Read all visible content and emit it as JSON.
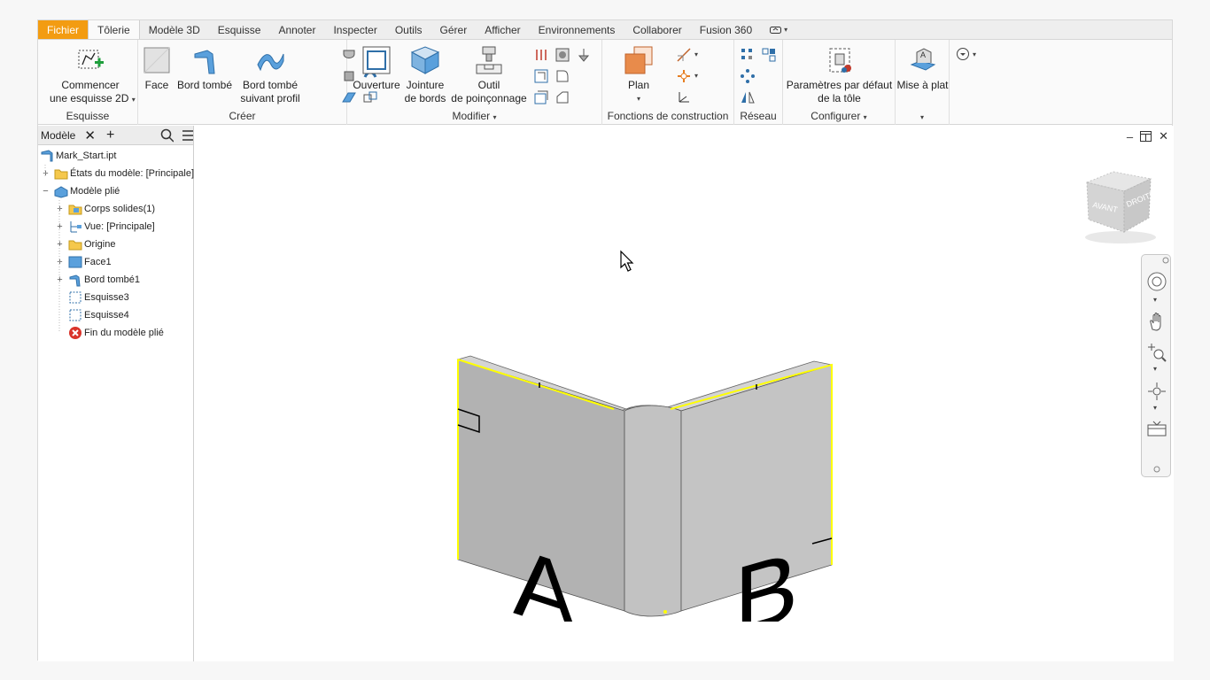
{
  "menu": {
    "tabs": [
      "Fichier",
      "Tôlerie",
      "Modèle 3D",
      "Esquisse",
      "Annoter",
      "Inspecter",
      "Outils",
      "Gérer",
      "Afficher",
      "Environnements",
      "Collaborer",
      "Fusion 360"
    ]
  },
  "ribbon": {
    "esquisse": {
      "start_line1": "Commencer",
      "start_line2": "une esquisse 2D",
      "title": "Esquisse"
    },
    "creer": {
      "face": "Face",
      "bord_tombe": "Bord tombé",
      "bord_profil_line1": "Bord tombé",
      "bord_profil_line2": "suivant profil",
      "title": "Créer"
    },
    "modifier": {
      "ouverture": "Ouverture",
      "jointure_line1": "Jointure",
      "jointure_line2": "de bords",
      "outil_line1": "Outil",
      "outil_line2": "de poinçonnage",
      "title": "Modifier"
    },
    "construction": {
      "plan": "Plan",
      "title": "Fonctions de construction"
    },
    "reseau": {
      "title": "Réseau"
    },
    "configurer": {
      "param_line1": "Paramètres par défaut",
      "param_line2": "de la tôle",
      "title": "Configurer"
    },
    "flatten": {
      "label": "Mise à plat"
    }
  },
  "browser": {
    "tab_label": "Modèle",
    "items": [
      {
        "label": "Mark_Start.ipt"
      },
      {
        "label": "États du modèle: [Principale]"
      },
      {
        "label": "Modèle plié"
      },
      {
        "label": "Corps solides(1)"
      },
      {
        "label": "Vue: [Principale]"
      },
      {
        "label": "Origine"
      },
      {
        "label": "Face1"
      },
      {
        "label": "Bord tombé1"
      },
      {
        "label": "Esquisse3"
      },
      {
        "label": "Esquisse4"
      },
      {
        "label": "Fin du modèle plié"
      }
    ]
  },
  "viewcube": {
    "front": "AVANT",
    "right": "DROITE"
  },
  "model": {
    "letter_a": "A",
    "letter_b": "B"
  },
  "colors": {
    "file_tab": "#f39c12",
    "highlight_edge": "#ffff00",
    "part_face": "#bdbdbd"
  }
}
